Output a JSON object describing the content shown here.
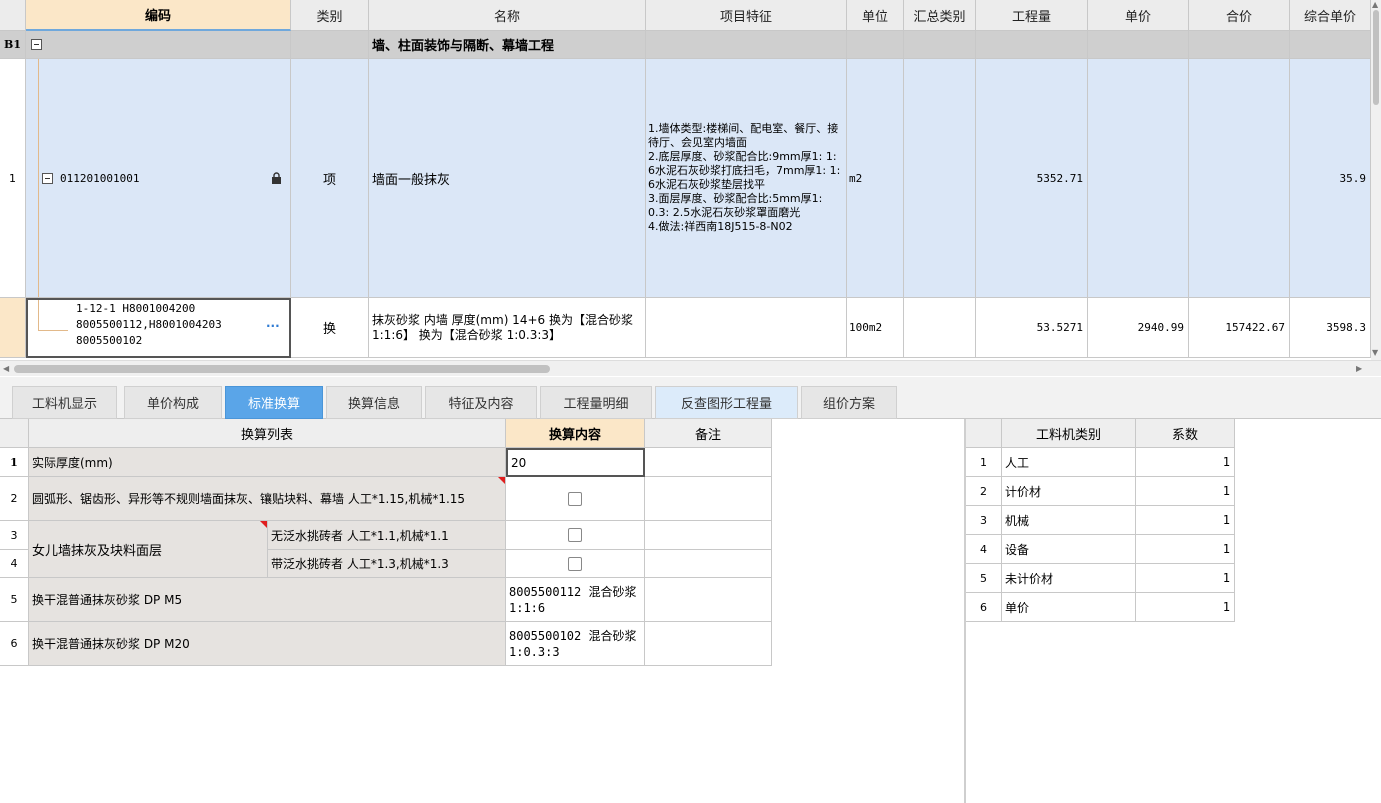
{
  "top_grid": {
    "headers": [
      "编码",
      "类别",
      "名称",
      "项目特征",
      "单位",
      "汇总类别",
      "工程量",
      "单价",
      "合价",
      "综合单价"
    ],
    "section_row": {
      "label": "B1",
      "name": "墙、柱面装饰与隔断、幕墙工程"
    },
    "item_row": {
      "index": "1",
      "code": "011201001001",
      "category": "项",
      "name": "墙面一般抹灰",
      "features": "1.墙体类型:楼梯间、配电室、餐厅、接待厅、会见室内墙面\n2.底层厚度、砂浆配合比:9mm厚1: 1: 6水泥石灰砂浆打底扫毛，7mm厚1: 1: 6水泥石灰砂浆垫层找平\n3.面层厚度、砂浆配合比:5mm厚1: 0.3: 2.5水泥石灰砂浆罩面磨光\n4.做法:祥西南18J515-8-N02",
      "unit": "m2",
      "quantity": "5352.71",
      "composite_price": "35.9"
    },
    "sub_row": {
      "code_line1": "1-12-1 H8001004200",
      "code_line2": "8005500112,H8001004203",
      "code_line3": "8005500102",
      "more": "···",
      "category": "换",
      "name": "抹灰砂浆 内墙 厚度(mm) 14+6  换为【混合砂浆 1:1:6】  换为【混合砂浆 1:0.3:3】",
      "unit": "100m2",
      "quantity": "53.5271",
      "price": "2940.99",
      "total": "157422.67",
      "composite_price": "3598.3"
    }
  },
  "tabs": [
    "工料机显示",
    "单价构成",
    "标准换算",
    "换算信息",
    "特征及内容",
    "工程量明细",
    "反查图形工程量",
    "组价方案"
  ],
  "active_tab": "标准换算",
  "conversion": {
    "headers": [
      "换算列表",
      "换算内容",
      "备注"
    ],
    "rows": [
      {
        "n": "1",
        "label": "实际厚度(mm)",
        "value": "20"
      },
      {
        "n": "2",
        "label": "圆弧形、锯齿形、异形等不规则墙面抹灰、镶贴块料、幕墙 人工*1.15,机械*1.15"
      },
      {
        "n": "3",
        "group": "女儿墙抹灰及块料面层",
        "label": "无泛水挑砖者 人工*1.1,机械*1.1"
      },
      {
        "n": "4",
        "label": "带泛水挑砖者 人工*1.3,机械*1.3"
      },
      {
        "n": "5",
        "label": "换干混普通抹灰砂浆 DP M5",
        "value": "8005500112  混合砂浆 1:1:6"
      },
      {
        "n": "6",
        "label": "换干混普通抹灰砂浆 DP M20",
        "value": "8005500102  混合砂浆 1:0.3:3"
      }
    ]
  },
  "coeff": {
    "headers": [
      "工料机类别",
      "系数"
    ],
    "rows": [
      {
        "n": "1",
        "type": "人工",
        "value": "1"
      },
      {
        "n": "2",
        "type": "计价材",
        "value": "1"
      },
      {
        "n": "3",
        "type": "机械",
        "value": "1"
      },
      {
        "n": "4",
        "type": "设备",
        "value": "1"
      },
      {
        "n": "5",
        "type": "未计价材",
        "value": "1"
      },
      {
        "n": "6",
        "type": "单价",
        "value": "1"
      }
    ]
  },
  "colors": {
    "accent": "#5aa5e8",
    "selected_header": "#fbe7c8",
    "row_highlight": "#dbe7f7",
    "section_gray": "#cfcfcf"
  }
}
